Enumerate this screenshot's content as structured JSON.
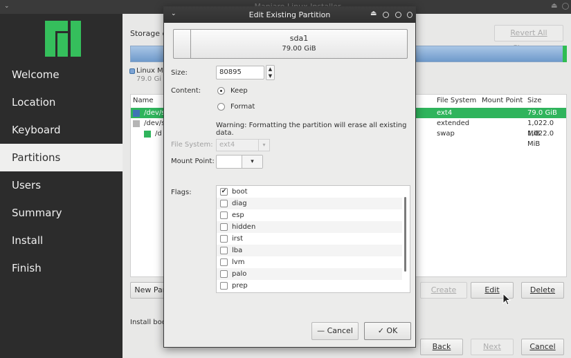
{
  "window": {
    "title": "Manjaro Linux Installer",
    "menu_glyph": "⌄",
    "eject_glyph": "⏏"
  },
  "sidebar": {
    "items": [
      {
        "label": "Welcome"
      },
      {
        "label": "Location"
      },
      {
        "label": "Keyboard"
      },
      {
        "label": "Partitions",
        "active": true
      },
      {
        "label": "Users"
      },
      {
        "label": "Summary"
      },
      {
        "label": "Install"
      },
      {
        "label": "Finish"
      }
    ],
    "logo_color": "#35bf5c"
  },
  "main": {
    "storage_label": "Storage de",
    "revert_label": "Revert All Changes",
    "legend": {
      "label": "Linux M",
      "size": "79.0 Gi"
    },
    "table": {
      "headers": {
        "name": "Name",
        "fs": "File System",
        "mount": "Mount Point",
        "size": "Size"
      },
      "rows": [
        {
          "name": "/dev/s",
          "fs": "ext4",
          "mount": "",
          "size": "79.0 GiB",
          "selected": true,
          "color": "#3f74b5"
        },
        {
          "name": "/dev/s",
          "fs": "extended",
          "mount": "",
          "size": "1,022.0 MiB",
          "selected": false,
          "color": "#b5b5b5"
        },
        {
          "name": "/d",
          "fs": "swap",
          "mount": "",
          "size": "1,022.0 MiB",
          "selected": false,
          "color": "#2fb45c"
        }
      ]
    },
    "buttons": {
      "new_partition": "New Part",
      "create": "Create",
      "edit": "Edit",
      "delete": "Delete",
      "back": "Back",
      "next": "Next",
      "cancel": "Cancel"
    },
    "install_boot_label": "Install boo"
  },
  "dialog": {
    "title": "Edit Existing Partition",
    "partition": {
      "name": "sda1",
      "size": "79.00 GiB"
    },
    "size_label": "Size:",
    "size_value": "80895",
    "content_label": "Content:",
    "keep_label": "Keep",
    "format_label": "Format",
    "content_selected": "keep",
    "warning": "Warning: Formatting the partition will erase all existing data.",
    "filesystem_label": "File System:",
    "filesystem_value": "ext4",
    "mountpoint_label": "Mount Point:",
    "mountpoint_value": "",
    "flags_label": "Flags:",
    "flags": [
      {
        "name": "boot",
        "checked": true
      },
      {
        "name": "diag",
        "checked": false
      },
      {
        "name": "esp",
        "checked": false
      },
      {
        "name": "hidden",
        "checked": false
      },
      {
        "name": "irst",
        "checked": false
      },
      {
        "name": "lba",
        "checked": false
      },
      {
        "name": "lvm",
        "checked": false
      },
      {
        "name": "palo",
        "checked": false
      },
      {
        "name": "prep",
        "checked": false
      }
    ],
    "cancel_label": "Cancel",
    "ok_label": "OK"
  }
}
